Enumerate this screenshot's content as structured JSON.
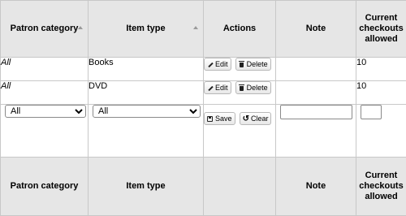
{
  "headers": {
    "patron_category": "Patron category",
    "item_type": "Item type",
    "actions": "Actions",
    "note": "Note",
    "checkouts_line1": "Current",
    "checkouts_line2": "checkouts",
    "checkouts_line3": "allowed"
  },
  "rows": [
    {
      "patron_category": "All",
      "item_type": "Books",
      "note": "",
      "checkouts": "10"
    },
    {
      "patron_category": "All",
      "item_type": "DVD",
      "note": "",
      "checkouts": "10"
    }
  ],
  "buttons": {
    "edit": "Edit",
    "delete": "Delete",
    "save": "Save",
    "clear": "Clear"
  },
  "edit_row": {
    "patron_category_selected": "All",
    "item_type_selected": "All",
    "note_value": "",
    "checkouts_value": ""
  },
  "footers": {
    "patron_category": "Patron category",
    "item_type": "Item type",
    "note": "Note",
    "checkouts_line1": "Current",
    "checkouts_line2": "checkouts",
    "checkouts_line3": "allowed"
  }
}
